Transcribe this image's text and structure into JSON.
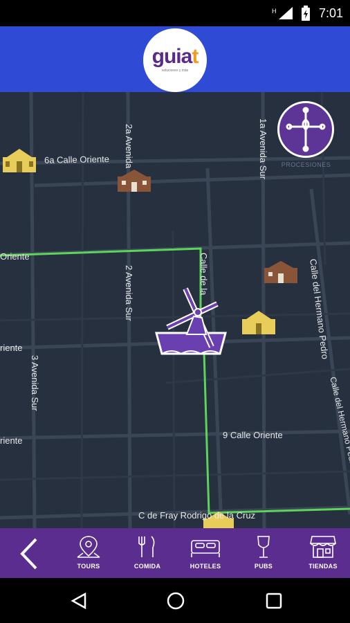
{
  "status_bar": {
    "time": "7:01"
  },
  "app_bar": {
    "logo_main": "guia",
    "logo_accent": "t",
    "logo_sub": "soluciones y más"
  },
  "map": {
    "streets": {
      "calle_6a_oriente": "6a Calle Oriente",
      "avenida_2a_top": "2a Avenida",
      "avenida_1a_sur": "1a Avenida Sur",
      "oriente_left_1": "Oriente",
      "calle_top_mid": "Calle de la",
      "avenida_2_sur": "2 Avenida Sur",
      "calle_hermano_pedro_1": "Calle del Hermano Pedro",
      "calle_hermano_pedro_2": "Calle del Hermano Pedro",
      "oriente_left_2": "riente",
      "avenida_3_sur": "3 Avenida Sur",
      "oriente_left_3": "riente",
      "calle_9_oriente": "9 Calle Oriente",
      "fray_rodrigo": "C de Fray Rodrigo de la Cruz"
    },
    "route_color": "#5fd45a",
    "procesiones_button": {
      "label": "PROCESIONES",
      "icon": "cross-icon"
    }
  },
  "bottom_nav": {
    "back_icon": "chevron-left-icon",
    "items": [
      {
        "label": "TOURS",
        "icon": "map-pin-icon"
      },
      {
        "label": "COMIDA",
        "icon": "fork-knife-icon"
      },
      {
        "label": "HOTELES",
        "icon": "bed-icon"
      },
      {
        "label": "PUBS",
        "icon": "wine-glass-icon"
      },
      {
        "label": "TIENDAS",
        "icon": "store-icon"
      }
    ]
  },
  "colors": {
    "app_bar": "#2f4bd6",
    "bottom_nav": "#5a2d8f",
    "map_bg": "#26303f",
    "accent": "#f39a1f"
  }
}
